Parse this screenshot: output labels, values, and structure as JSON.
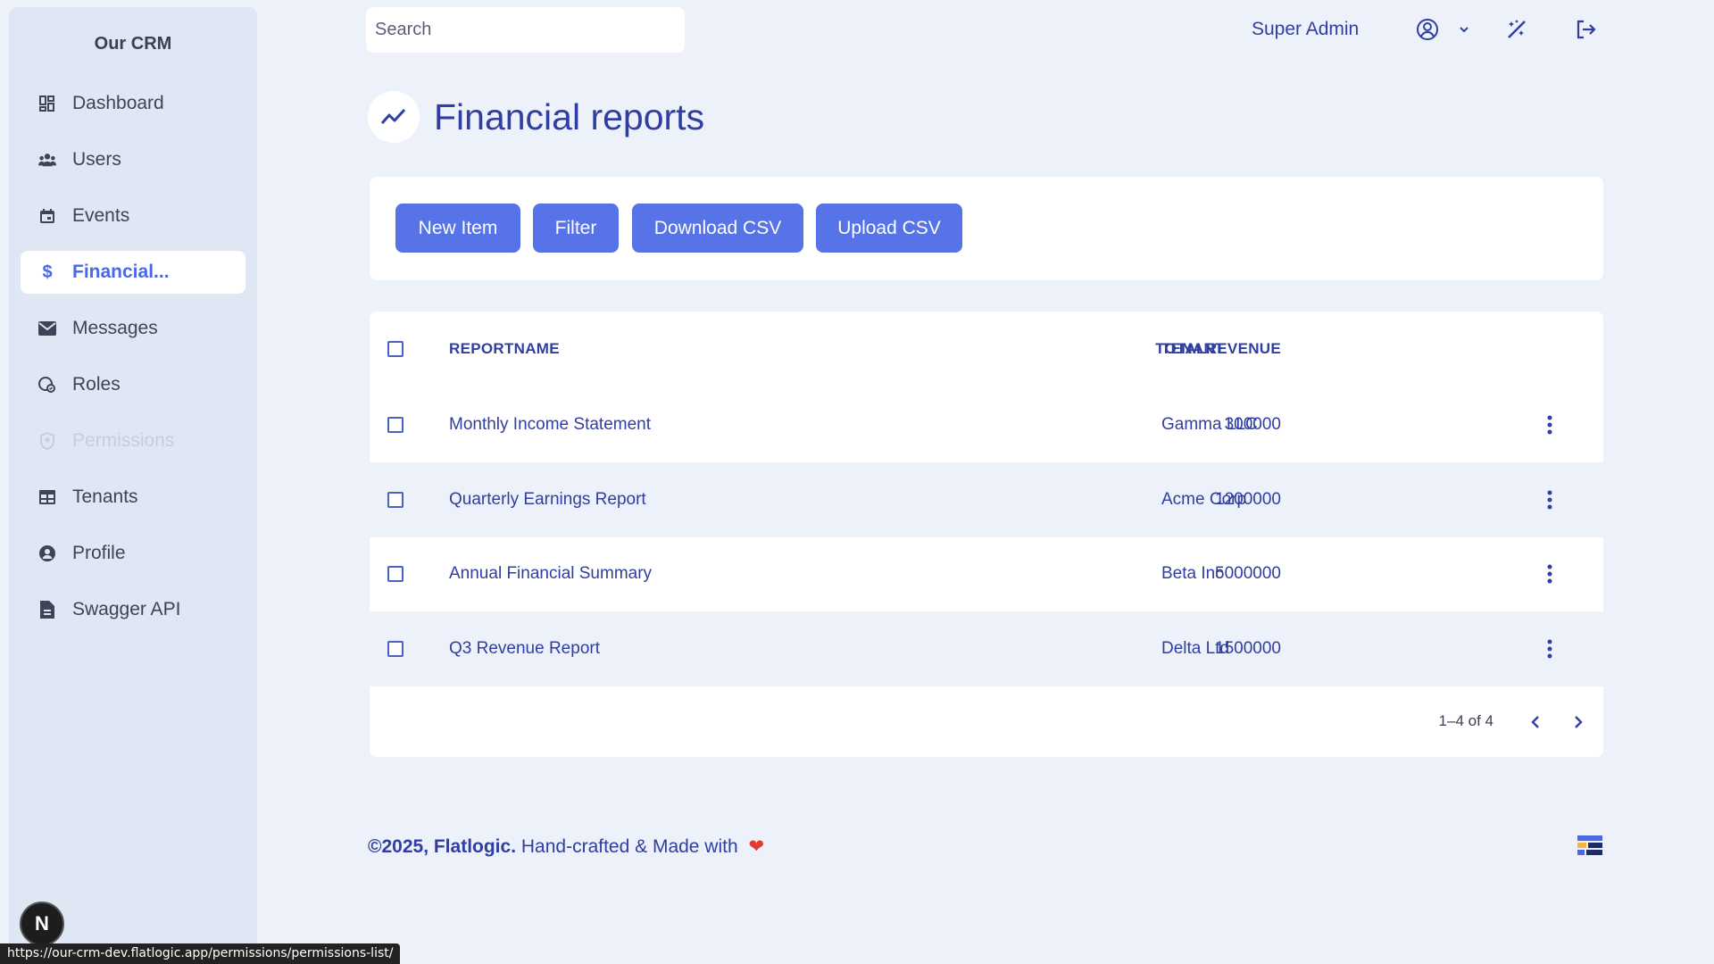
{
  "app": {
    "brand": "Our CRM"
  },
  "sidebar": {
    "items": [
      {
        "label": "Dashboard",
        "icon": "dashboard-icon"
      },
      {
        "label": "Users",
        "icon": "users-icon"
      },
      {
        "label": "Events",
        "icon": "calendar-icon"
      },
      {
        "label": "Financial...",
        "icon": "dollar-icon",
        "active": true
      },
      {
        "label": "Messages",
        "icon": "mail-icon"
      },
      {
        "label": "Roles",
        "icon": "roles-icon"
      },
      {
        "label": "Permissions",
        "icon": "shield-icon",
        "disabled": true
      },
      {
        "label": "Tenants",
        "icon": "table-icon"
      },
      {
        "label": "Profile",
        "icon": "user-circle-icon"
      },
      {
        "label": "Swagger API",
        "icon": "file-icon"
      }
    ]
  },
  "topbar": {
    "search_placeholder": "Search",
    "user_name": "Super Admin"
  },
  "page": {
    "title": "Financial reports"
  },
  "toolbar": {
    "new_item": "New Item",
    "filter": "Filter",
    "download_csv": "Download CSV",
    "upload_csv": "Upload CSV"
  },
  "table": {
    "headers": {
      "name": "REPORTNAME",
      "revenue": "TOTALREVENUE",
      "tenant": "TENANT"
    },
    "rows": [
      {
        "name": "Monthly Income Statement",
        "revenue": "300000",
        "tenant": "Gamma LLC"
      },
      {
        "name": "Quarterly Earnings Report",
        "revenue": "1200000",
        "tenant": "Acme Corp"
      },
      {
        "name": "Annual Financial Summary",
        "revenue": "5000000",
        "tenant": "Beta Inc"
      },
      {
        "name": "Q3 Revenue Report",
        "revenue": "1500000",
        "tenant": "Delta Ltd"
      }
    ],
    "pagination": "1–4 of 4"
  },
  "footer": {
    "copyright": "©2025, Flatlogic.",
    "tagline": "Hand-crafted & Made with"
  },
  "bottom": {
    "avatar_letter": "N",
    "status_url": "https://our-crm-dev.flatlogic.app/permissions/permissions-list/"
  },
  "colors": {
    "accent": "#5773e8",
    "text": "#2f3ea0",
    "background": "#edf1fa",
    "heart": "#e53935"
  }
}
